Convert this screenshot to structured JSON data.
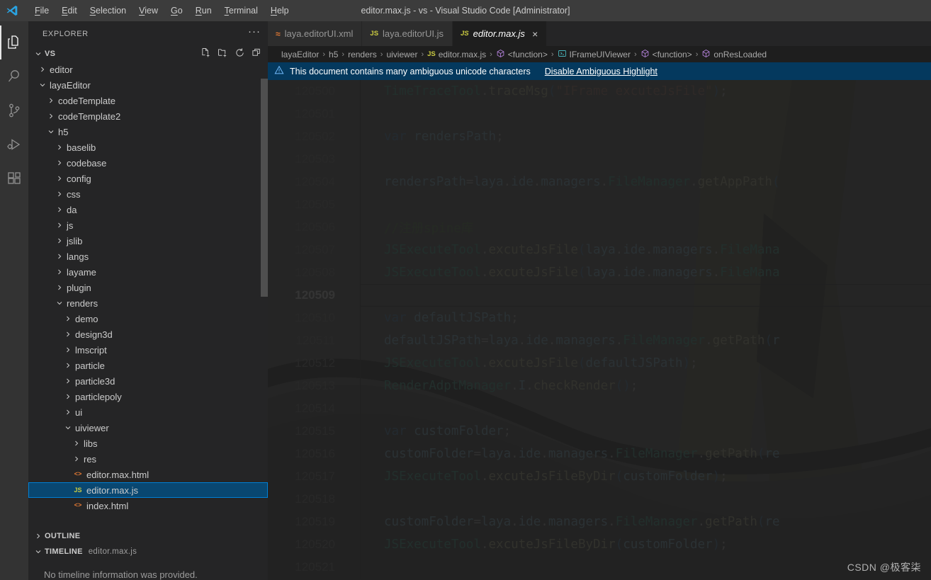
{
  "window": {
    "title": "editor.max.js - vs - Visual Studio Code [Administrator]",
    "logo_icon": "vscode-logo-icon"
  },
  "menubar": {
    "items": [
      {
        "label": "File"
      },
      {
        "label": "Edit"
      },
      {
        "label": "Selection"
      },
      {
        "label": "View"
      },
      {
        "label": "Go"
      },
      {
        "label": "Run"
      },
      {
        "label": "Terminal"
      },
      {
        "label": "Help"
      }
    ]
  },
  "activitybar": {
    "items": [
      {
        "name": "explorer-icon",
        "active": true
      },
      {
        "name": "search-icon",
        "active": false
      },
      {
        "name": "source-control-icon",
        "active": false
      },
      {
        "name": "run-and-debug-icon",
        "active": false
      },
      {
        "name": "extensions-icon",
        "active": false
      }
    ]
  },
  "sidebar": {
    "title": "EXPLORER",
    "more_actions": "···",
    "root_folder": "VS",
    "actions": [
      {
        "name": "new-file-icon"
      },
      {
        "name": "new-folder-icon"
      },
      {
        "name": "refresh-explorer-icon"
      },
      {
        "name": "collapse-folders-icon"
      }
    ],
    "tree": [
      {
        "label": "editor",
        "indent": 1,
        "kind": "folder",
        "expanded": false,
        "highlight": false
      },
      {
        "label": "layaEditor",
        "indent": 1,
        "kind": "folder",
        "expanded": true,
        "highlight": true
      },
      {
        "label": "codeTemplate",
        "indent": 2,
        "kind": "folder",
        "expanded": false,
        "highlight": false
      },
      {
        "label": "codeTemplate2",
        "indent": 2,
        "kind": "folder",
        "expanded": false,
        "highlight": false
      },
      {
        "label": "h5",
        "indent": 2,
        "kind": "folder",
        "expanded": true,
        "highlight": true
      },
      {
        "label": "baselib",
        "indent": 3,
        "kind": "folder",
        "expanded": false,
        "highlight": false
      },
      {
        "label": "codebase",
        "indent": 3,
        "kind": "folder",
        "expanded": false,
        "highlight": false
      },
      {
        "label": "config",
        "indent": 3,
        "kind": "folder",
        "expanded": false,
        "highlight": false
      },
      {
        "label": "css",
        "indent": 3,
        "kind": "folder",
        "expanded": false,
        "highlight": false
      },
      {
        "label": "da",
        "indent": 3,
        "kind": "folder",
        "expanded": false,
        "highlight": false
      },
      {
        "label": "js",
        "indent": 3,
        "kind": "folder",
        "expanded": false,
        "highlight": false
      },
      {
        "label": "jslib",
        "indent": 3,
        "kind": "folder",
        "expanded": false,
        "highlight": false
      },
      {
        "label": "langs",
        "indent": 3,
        "kind": "folder",
        "expanded": false,
        "highlight": false
      },
      {
        "label": "layame",
        "indent": 3,
        "kind": "folder",
        "expanded": false,
        "highlight": false
      },
      {
        "label": "plugin",
        "indent": 3,
        "kind": "folder",
        "expanded": false,
        "highlight": false
      },
      {
        "label": "renders",
        "indent": 3,
        "kind": "folder",
        "expanded": true,
        "highlight": true
      },
      {
        "label": "demo",
        "indent": 4,
        "kind": "folder",
        "expanded": false,
        "highlight": false
      },
      {
        "label": "design3d",
        "indent": 4,
        "kind": "folder",
        "expanded": false,
        "highlight": false
      },
      {
        "label": "lmscript",
        "indent": 4,
        "kind": "folder",
        "expanded": false,
        "highlight": false
      },
      {
        "label": "particle",
        "indent": 4,
        "kind": "folder",
        "expanded": false,
        "highlight": false
      },
      {
        "label": "particle3d",
        "indent": 4,
        "kind": "folder",
        "expanded": false,
        "highlight": false
      },
      {
        "label": "particlepoly",
        "indent": 4,
        "kind": "folder",
        "expanded": false,
        "highlight": false
      },
      {
        "label": "ui",
        "indent": 4,
        "kind": "folder",
        "expanded": false,
        "highlight": false
      },
      {
        "label": "uiviewer",
        "indent": 4,
        "kind": "folder",
        "expanded": true,
        "highlight": true
      },
      {
        "label": "libs",
        "indent": 5,
        "kind": "folder",
        "expanded": false,
        "highlight": false
      },
      {
        "label": "res",
        "indent": 5,
        "kind": "folder",
        "expanded": false,
        "highlight": false
      },
      {
        "label": "editor.max.html",
        "indent": 5,
        "kind": "html",
        "expanded": false,
        "highlight": false
      },
      {
        "label": "editor.max.js",
        "indent": 5,
        "kind": "js",
        "expanded": false,
        "highlight": true,
        "selected": true
      },
      {
        "label": "index.html",
        "indent": 5,
        "kind": "html",
        "expanded": false,
        "highlight": false
      }
    ],
    "outline": {
      "label": "OUTLINE",
      "expanded": false
    },
    "timeline": {
      "label": "TIMELINE",
      "subtitle": "editor.max.js",
      "expanded": true,
      "empty_message": "No timeline information was provided."
    }
  },
  "editor": {
    "tabs": [
      {
        "label": "laya.editorUI.xml",
        "icon": "xml-file-icon",
        "icon_glyph": "☳",
        "active": false,
        "closable": false
      },
      {
        "label": "laya.editorUI.js",
        "icon": "js-file-icon",
        "icon_glyph": "JS",
        "active": false,
        "closable": false
      },
      {
        "label": "editor.max.js",
        "icon": "js-file-icon",
        "icon_glyph": "JS",
        "active": true,
        "closable": true,
        "close_glyph": "×"
      }
    ],
    "breadcrumbs": [
      {
        "label": "layaEditor",
        "symbol": ""
      },
      {
        "label": "h5",
        "symbol": ""
      },
      {
        "label": "renders",
        "symbol": ""
      },
      {
        "label": "uiviewer",
        "symbol": ""
      },
      {
        "label": "editor.max.js",
        "symbol": "js"
      },
      {
        "label": "<function>",
        "symbol": "cube"
      },
      {
        "label": "IFrameUIViewer",
        "symbol": "iface"
      },
      {
        "label": "<function>",
        "symbol": "cube"
      },
      {
        "label": "onResLoaded",
        "symbol": "cube"
      }
    ],
    "notification": {
      "icon": "warning-icon",
      "message": "This document contains many ambiguous unicode characters",
      "action_label": "Disable Ambiguous Highlight"
    },
    "current_line": 120509,
    "lines": [
      {
        "n": 120500,
        "tokens": [
          {
            "t": "cls",
            "s": "TimeTraceTool"
          },
          {
            "t": "pun",
            "s": "."
          },
          {
            "t": "fn",
            "s": "traceMsg"
          },
          {
            "t": "par",
            "s": "("
          },
          {
            "t": "str",
            "s": "\"IFrame excuteJsFile\""
          },
          {
            "t": "par",
            "s": ")"
          },
          {
            "t": "pun",
            "s": ";"
          }
        ]
      },
      {
        "n": 120501,
        "tokens": []
      },
      {
        "n": 120502,
        "tokens": [
          {
            "t": "kw",
            "s": "var"
          },
          {
            "t": "pun",
            "s": " "
          },
          {
            "t": "var",
            "s": "rendersPath"
          },
          {
            "t": "pun",
            "s": ";"
          }
        ]
      },
      {
        "n": 120503,
        "tokens": []
      },
      {
        "n": 120504,
        "tokens": [
          {
            "t": "var",
            "s": "rendersPath"
          },
          {
            "t": "pun",
            "s": "="
          },
          {
            "t": "var",
            "s": "laya"
          },
          {
            "t": "pun",
            "s": "."
          },
          {
            "t": "var",
            "s": "ide"
          },
          {
            "t": "pun",
            "s": "."
          },
          {
            "t": "var",
            "s": "managers"
          },
          {
            "t": "pun",
            "s": "."
          },
          {
            "t": "cls",
            "s": "FileManager"
          },
          {
            "t": "pun",
            "s": "."
          },
          {
            "t": "fn",
            "s": "getAppPath"
          },
          {
            "t": "par",
            "s": "("
          }
        ]
      },
      {
        "n": 120505,
        "tokens": []
      },
      {
        "n": 120506,
        "tokens": [
          {
            "t": "cmt",
            "s": "//注册spine库"
          }
        ]
      },
      {
        "n": 120507,
        "tokens": [
          {
            "t": "cls",
            "s": "JSExecuteTool"
          },
          {
            "t": "pun",
            "s": "."
          },
          {
            "t": "fn",
            "s": "excuteJsFile"
          },
          {
            "t": "par",
            "s": "("
          },
          {
            "t": "var",
            "s": "laya"
          },
          {
            "t": "pun",
            "s": "."
          },
          {
            "t": "var",
            "s": "ide"
          },
          {
            "t": "pun",
            "s": "."
          },
          {
            "t": "var",
            "s": "managers"
          },
          {
            "t": "pun",
            "s": "."
          },
          {
            "t": "cls",
            "s": "FileMana"
          }
        ]
      },
      {
        "n": 120508,
        "tokens": [
          {
            "t": "cls",
            "s": "JSExecuteTool"
          },
          {
            "t": "pun",
            "s": "."
          },
          {
            "t": "fn",
            "s": "excuteJsFile"
          },
          {
            "t": "par",
            "s": "("
          },
          {
            "t": "var",
            "s": "laya"
          },
          {
            "t": "pun",
            "s": "."
          },
          {
            "t": "var",
            "s": "ide"
          },
          {
            "t": "pun",
            "s": "."
          },
          {
            "t": "var",
            "s": "managers"
          },
          {
            "t": "pun",
            "s": "."
          },
          {
            "t": "cls",
            "s": "FileMana"
          }
        ]
      },
      {
        "n": 120509,
        "tokens": []
      },
      {
        "n": 120510,
        "tokens": [
          {
            "t": "kw",
            "s": "var"
          },
          {
            "t": "pun",
            "s": " "
          },
          {
            "t": "var",
            "s": "defaultJSPath"
          },
          {
            "t": "pun",
            "s": ";"
          }
        ]
      },
      {
        "n": 120511,
        "tokens": [
          {
            "t": "var",
            "s": "defaultJSPath"
          },
          {
            "t": "pun",
            "s": "="
          },
          {
            "t": "var",
            "s": "laya"
          },
          {
            "t": "pun",
            "s": "."
          },
          {
            "t": "var",
            "s": "ide"
          },
          {
            "t": "pun",
            "s": "."
          },
          {
            "t": "var",
            "s": "managers"
          },
          {
            "t": "pun",
            "s": "."
          },
          {
            "t": "cls",
            "s": "FileManager"
          },
          {
            "t": "pun",
            "s": "."
          },
          {
            "t": "fn",
            "s": "getPath"
          },
          {
            "t": "par",
            "s": "("
          },
          {
            "t": "var",
            "s": "r"
          }
        ]
      },
      {
        "n": 120512,
        "tokens": [
          {
            "t": "cls",
            "s": "JSExecuteTool"
          },
          {
            "t": "pun",
            "s": "."
          },
          {
            "t": "fn",
            "s": "excuteJsFile"
          },
          {
            "t": "par",
            "s": "("
          },
          {
            "t": "var",
            "s": "defaultJSPath"
          },
          {
            "t": "par",
            "s": ")"
          },
          {
            "t": "pun",
            "s": ";"
          }
        ]
      },
      {
        "n": 120513,
        "tokens": [
          {
            "t": "cls",
            "s": "RenderAdptManager"
          },
          {
            "t": "pun",
            "s": "."
          },
          {
            "t": "var",
            "s": "I"
          },
          {
            "t": "pun",
            "s": "."
          },
          {
            "t": "fn",
            "s": "checkRender"
          },
          {
            "t": "par",
            "s": "()"
          },
          {
            "t": "pun",
            "s": ";"
          }
        ]
      },
      {
        "n": 120514,
        "tokens": []
      },
      {
        "n": 120515,
        "tokens": [
          {
            "t": "kw",
            "s": "var"
          },
          {
            "t": "pun",
            "s": " "
          },
          {
            "t": "var",
            "s": "customFolder"
          },
          {
            "t": "pun",
            "s": ";"
          }
        ]
      },
      {
        "n": 120516,
        "tokens": [
          {
            "t": "var",
            "s": "customFolder"
          },
          {
            "t": "pun",
            "s": "="
          },
          {
            "t": "var",
            "s": "laya"
          },
          {
            "t": "pun",
            "s": "."
          },
          {
            "t": "var",
            "s": "ide"
          },
          {
            "t": "pun",
            "s": "."
          },
          {
            "t": "var",
            "s": "managers"
          },
          {
            "t": "pun",
            "s": "."
          },
          {
            "t": "cls",
            "s": "FileManager"
          },
          {
            "t": "pun",
            "s": "."
          },
          {
            "t": "fn",
            "s": "getPath"
          },
          {
            "t": "par",
            "s": "("
          },
          {
            "t": "var",
            "s": "re"
          }
        ]
      },
      {
        "n": 120517,
        "tokens": [
          {
            "t": "cls",
            "s": "JSExecuteTool"
          },
          {
            "t": "pun",
            "s": "."
          },
          {
            "t": "fn",
            "s": "excuteJsFileByDir"
          },
          {
            "t": "par",
            "s": "("
          },
          {
            "t": "var",
            "s": "customFolder"
          },
          {
            "t": "par",
            "s": ")"
          },
          {
            "t": "pun",
            "s": ";"
          }
        ]
      },
      {
        "n": 120518,
        "tokens": []
      },
      {
        "n": 120519,
        "tokens": [
          {
            "t": "var",
            "s": "customFolder"
          },
          {
            "t": "pun",
            "s": "="
          },
          {
            "t": "var",
            "s": "laya"
          },
          {
            "t": "pun",
            "s": "."
          },
          {
            "t": "var",
            "s": "ide"
          },
          {
            "t": "pun",
            "s": "."
          },
          {
            "t": "var",
            "s": "managers"
          },
          {
            "t": "pun",
            "s": "."
          },
          {
            "t": "cls",
            "s": "FileManager"
          },
          {
            "t": "pun",
            "s": "."
          },
          {
            "t": "fn",
            "s": "getPath"
          },
          {
            "t": "par",
            "s": "("
          },
          {
            "t": "var",
            "s": "re"
          }
        ]
      },
      {
        "n": 120520,
        "tokens": [
          {
            "t": "cls",
            "s": "JSExecuteTool"
          },
          {
            "t": "pun",
            "s": "."
          },
          {
            "t": "fn",
            "s": "excuteJsFileByDir"
          },
          {
            "t": "par",
            "s": "("
          },
          {
            "t": "var",
            "s": "customFolder"
          },
          {
            "t": "par",
            "s": ")"
          },
          {
            "t": "pun",
            "s": ";"
          }
        ]
      },
      {
        "n": 120521,
        "tokens": []
      }
    ]
  },
  "watermark": "CSDN @极客柒",
  "colors": {
    "titlebar_bg": "#3c3c3c",
    "activitybar_bg": "#333333",
    "sidebar_bg": "#252526",
    "editor_bg": "#1e1e1e",
    "selection_blue": "#094771",
    "selection_border": "#007fd4",
    "notification_bg": "#04395e",
    "annotation_red": "#f01c1c",
    "js_icon": "#cbcb41",
    "html_icon": "#e37933"
  }
}
